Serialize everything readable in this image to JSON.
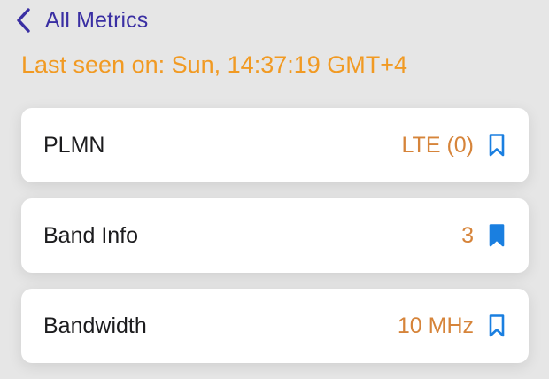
{
  "nav": {
    "back_label": "All Metrics",
    "back_icon": "chevron-left-icon"
  },
  "status": {
    "last_seen": "Last seen on: Sun, 14:37:19 GMT+4"
  },
  "metrics": [
    {
      "label": "PLMN",
      "value": "LTE (0)",
      "bookmarked": false,
      "icon": "bookmark-outline-icon"
    },
    {
      "label": "Band Info",
      "value": "3",
      "bookmarked": true,
      "icon": "bookmark-filled-icon"
    },
    {
      "label": "Bandwidth",
      "value": "10 MHz",
      "bookmarked": false,
      "icon": "bookmark-outline-icon"
    }
  ],
  "colors": {
    "background": "#e6e6e6",
    "nav_accent": "#3a2fa3",
    "last_seen": "#f19a23",
    "value": "#d6843a",
    "bookmark": "#1a7fe0",
    "card": "#ffffff"
  }
}
